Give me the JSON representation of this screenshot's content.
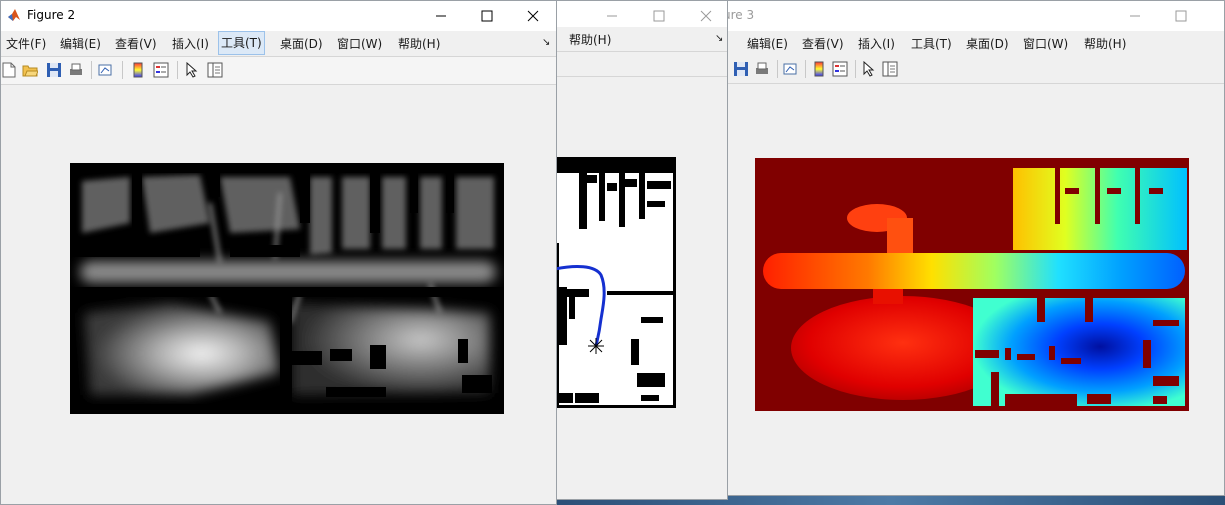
{
  "windows": {
    "figure2": {
      "title": "Figure 2",
      "menu": [
        "文件(F)",
        "编辑(E)",
        "查看(V)",
        "插入(I)",
        "工具(T)",
        "桌面(D)",
        "窗口(W)",
        "帮助(H)"
      ],
      "active_menu": "工具(T)",
      "overflow_glyph": "↘",
      "toolbar_icons": [
        "new-figure-icon",
        "open-file-icon",
        "save-icon",
        "print-icon",
        "link-plot-icon",
        "colorbar-icon",
        "legend-icon",
        "edit-plot-icon",
        "property-inspector-icon"
      ]
    },
    "figure1": {
      "menu": [
        "帮助(H)"
      ],
      "overflow_glyph": "↘"
    },
    "figure3": {
      "title": "ure 3",
      "menu": [
        "编辑(E)",
        "查看(V)",
        "插入(I)",
        "工具(T)",
        "桌面(D)",
        "窗口(W)",
        "帮助(H)"
      ],
      "toolbar_icons": [
        "save-icon",
        "print-icon",
        "link-plot-icon",
        "colorbar-icon",
        "legend-icon",
        "edit-plot-icon",
        "property-inspector-icon"
      ]
    }
  },
  "colors": {
    "path": "#1530d0",
    "field_background": "#800000",
    "matlab_orange": "#d9541b"
  }
}
